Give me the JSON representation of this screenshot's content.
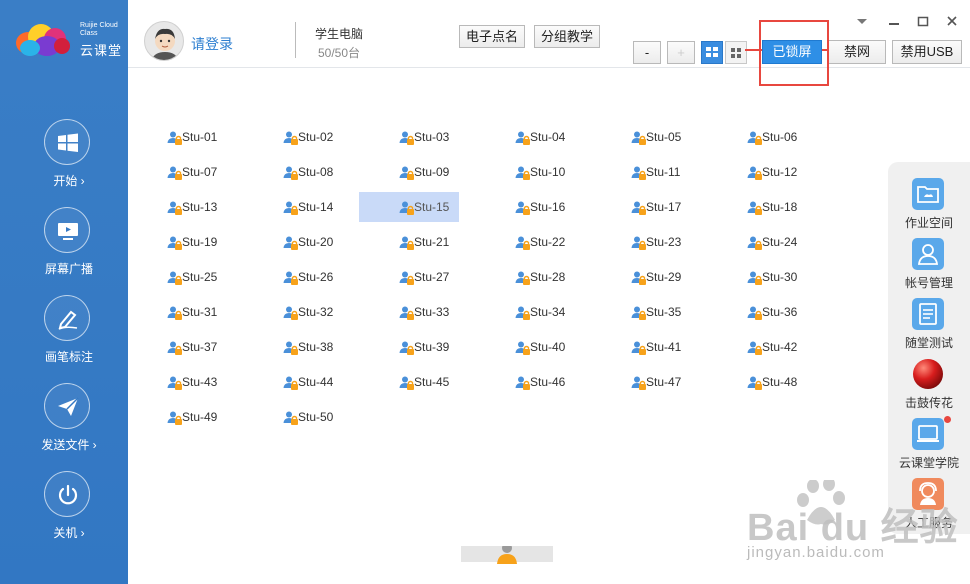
{
  "brand": {
    "name_en": "Ruijie Cloud Class",
    "name_cn": "云课堂"
  },
  "sidebar": {
    "items": [
      {
        "label": "开始 ›",
        "icon": "windows-icon"
      },
      {
        "label": "屏幕广播",
        "icon": "screen-broadcast-icon"
      },
      {
        "label": "画笔标注",
        "icon": "pen-annotate-icon"
      },
      {
        "label": "发送文件 ›",
        "icon": "send-file-icon"
      },
      {
        "label": "关机 ›",
        "icon": "power-icon"
      }
    ]
  },
  "header": {
    "login": "请登录",
    "pc_label": "学生电脑",
    "pc_count": "50/50台",
    "roll_call": "电子点名",
    "group_teaching": "分组教学",
    "zoom_out": "-",
    "zoom_in": "+",
    "lock_screen": "已锁屏",
    "ban_network": "禁网",
    "ban_usb": "禁用USB"
  },
  "students": [
    "Stu-01",
    "Stu-02",
    "Stu-03",
    "Stu-04",
    "Stu-05",
    "Stu-06",
    "Stu-07",
    "Stu-08",
    "Stu-09",
    "Stu-10",
    "Stu-11",
    "Stu-12",
    "Stu-13",
    "Stu-14",
    "Stu-15",
    "Stu-16",
    "Stu-17",
    "Stu-18",
    "Stu-19",
    "Stu-20",
    "Stu-21",
    "Stu-22",
    "Stu-23",
    "Stu-24",
    "Stu-25",
    "Stu-26",
    "Stu-27",
    "Stu-28",
    "Stu-29",
    "Stu-30",
    "Stu-31",
    "Stu-32",
    "Stu-33",
    "Stu-34",
    "Stu-35",
    "Stu-36",
    "Stu-37",
    "Stu-38",
    "Stu-39",
    "Stu-40",
    "Stu-41",
    "Stu-42",
    "Stu-43",
    "Stu-44",
    "Stu-45",
    "Stu-46",
    "Stu-47",
    "Stu-48",
    "Stu-49",
    "Stu-50"
  ],
  "selected_student": "Stu-15",
  "right_panel": {
    "items": [
      {
        "label": "作业空间",
        "icon": "homework-space-icon"
      },
      {
        "label": "帐号管理",
        "icon": "account-manage-icon"
      },
      {
        "label": "随堂测试",
        "icon": "quiz-icon"
      },
      {
        "label": "击鼓传花",
        "icon": "drum-ball-icon"
      },
      {
        "label": "云课堂学院",
        "icon": "academy-icon"
      },
      {
        "label": "人工服务",
        "icon": "service-icon"
      }
    ]
  },
  "watermark": {
    "brand": "Bai du 经验",
    "url": "jingyan.baidu.com"
  },
  "colors": {
    "sidebar": "#3579c5",
    "accent": "#2e8fe6",
    "lock_orange": "#f7a21a",
    "highlight": "#e8473f"
  }
}
